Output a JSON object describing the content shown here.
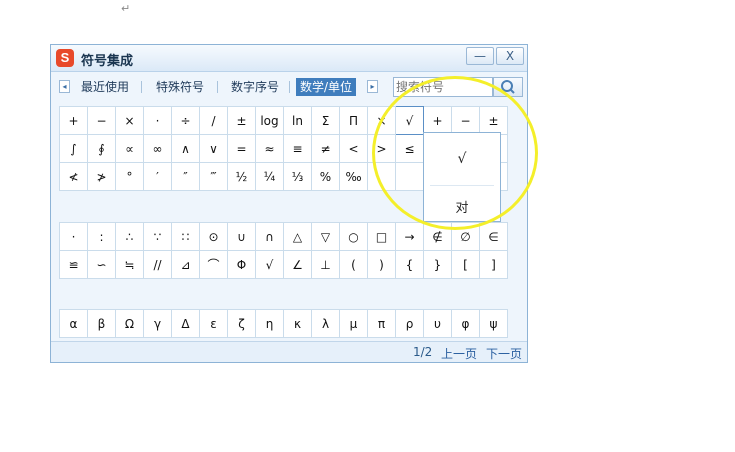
{
  "document": {
    "paragraph_mark": "↵"
  },
  "window": {
    "logo": "S",
    "title": "符号集成",
    "minimize": "—",
    "close": "X"
  },
  "tabs": {
    "prev_arrow": "◂",
    "next_arrow": "▸",
    "items": [
      "最近使用",
      "特殊符号",
      "数字序号",
      "数学/单位"
    ],
    "active": "数学/单位"
  },
  "search": {
    "placeholder": "搜索符号"
  },
  "grid_sections": [
    {
      "rows": [
        [
          "+",
          "−",
          "×",
          "·",
          "÷",
          "/",
          "±",
          "log",
          "ln",
          "Σ",
          "Π",
          "×",
          "√",
          "+",
          "−",
          "±"
        ],
        [
          "∫",
          "∮",
          "∝",
          "∞",
          "∧",
          "∨",
          "=",
          "≈",
          "≡",
          "≠",
          "<",
          ">",
          "≤",
          "≥",
          "≦",
          "≧"
        ],
        [
          "≮",
          "≯",
          "°",
          "′",
          "″",
          "‴",
          "½",
          "¼",
          "⅓",
          "%",
          "‰",
          "",
          "",
          "",
          "",
          ""
        ]
      ]
    },
    {
      "rows": [
        [
          "·",
          ":",
          "∴",
          "∵",
          "∷",
          "⊙",
          "∪",
          "∩",
          "△",
          "▽",
          "○",
          "□",
          "→",
          "∉",
          "∅",
          "∈"
        ],
        [
          "≌",
          "∽",
          "≒",
          "//",
          "⊿",
          "⌒",
          "Φ",
          "√",
          "∠",
          "⊥",
          "(",
          ")",
          "{",
          "}",
          "[",
          "]"
        ]
      ]
    },
    {
      "rows": [
        [
          "α",
          "β",
          "Ω",
          "γ",
          "Δ",
          "ε",
          "ζ",
          "η",
          "κ",
          "λ",
          "μ",
          "π",
          "ρ",
          "υ",
          "φ",
          "ψ"
        ]
      ]
    }
  ],
  "popup": {
    "symbol": "√",
    "word": "对"
  },
  "footer": {
    "page": "1/2",
    "prev": "上一页",
    "next": "下一页"
  },
  "colors": {
    "highlight_circle": "#f4ef2a",
    "active_tab": "#3f7dbd"
  }
}
